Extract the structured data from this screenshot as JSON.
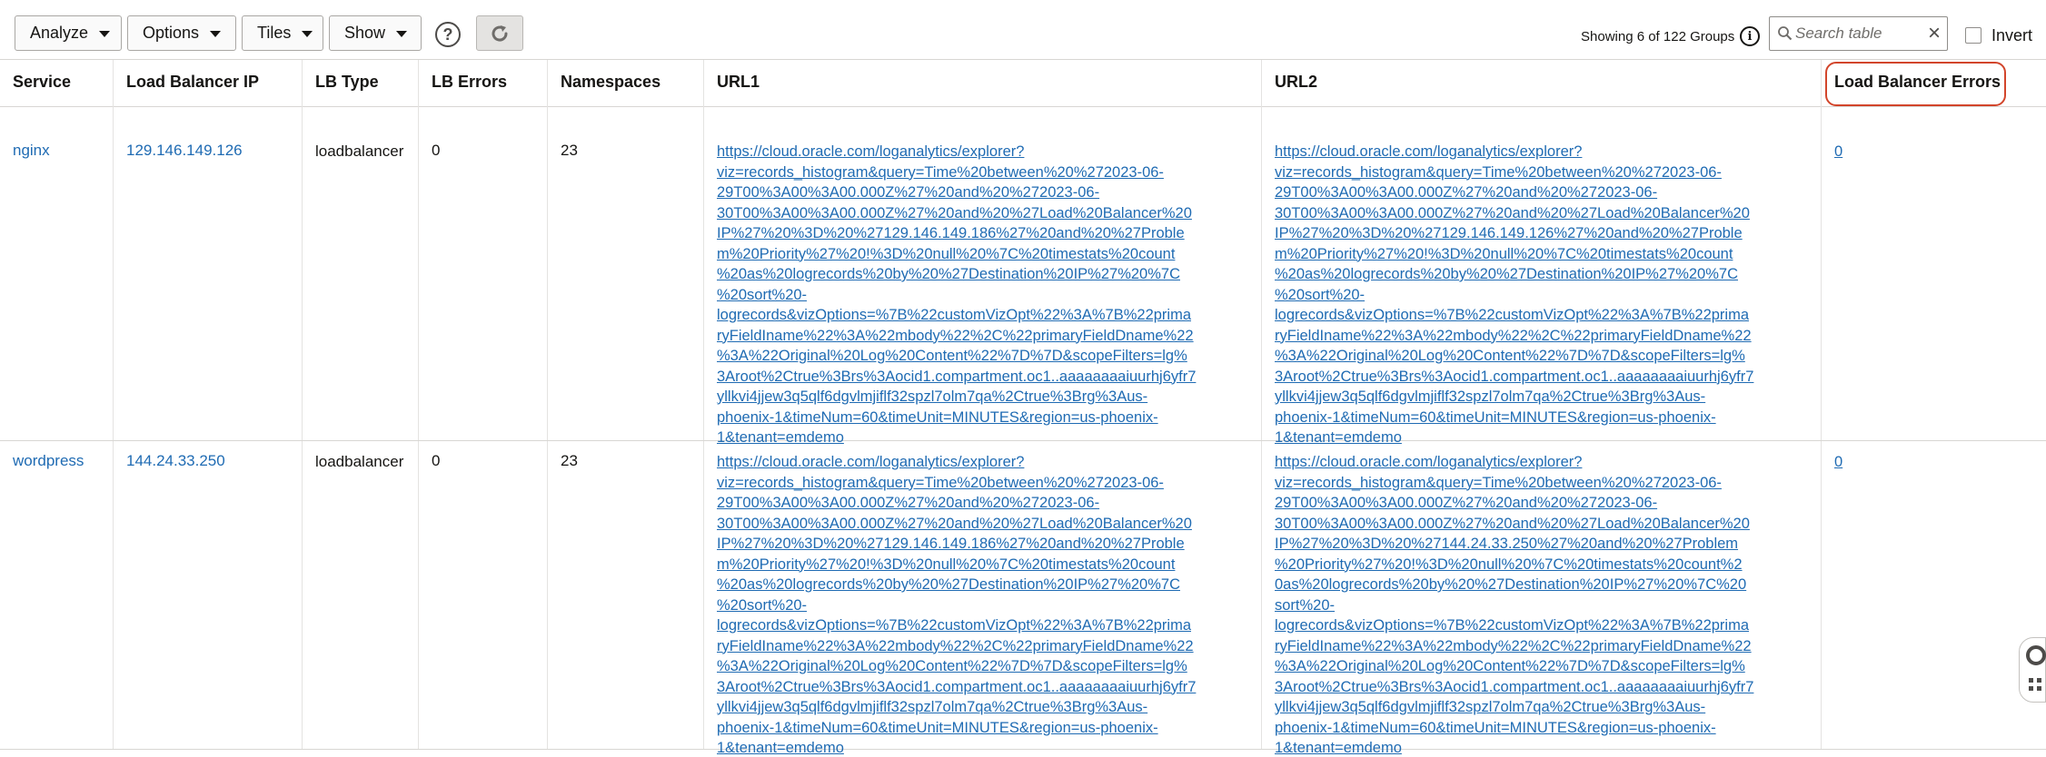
{
  "toolbar": {
    "analyze_label": "Analyze",
    "options_label": "Options",
    "tiles_label": "Tiles",
    "show_label": "Show",
    "help_glyph": "?",
    "showing_text": "Showing 6 of 122 Groups",
    "info_glyph": "i",
    "search_placeholder": "Search table",
    "clear_glyph": "×",
    "invert_label": "Invert",
    "icons": [
      "caret-down-icon",
      "help-icon",
      "refresh-icon",
      "info-icon",
      "search-icon",
      "close-icon"
    ]
  },
  "table": {
    "columns": [
      "Service",
      "Load Balancer IP",
      "LB Type",
      "LB Errors",
      "Namespaces",
      "URL1",
      "URL2",
      "Load Balancer Errors"
    ],
    "highlighted_column": "Load Balancer Errors",
    "rows": [
      {
        "service": "nginx",
        "ip": "129.146.149.126",
        "lb_type": "loadbalancer",
        "lb_errors": "0",
        "namespaces": "23",
        "url1": "https://cloud.oracle.com/loganalytics/explorer?\nviz=records_histogram&query=Time%20between%20%272023-06-\n29T00%3A00%3A00.000Z%27%20and%20%272023-06-\n30T00%3A00%3A00.000Z%27%20and%20%27Load%20Balancer%20\nIP%27%20%3D%20%27129.146.149.186%27%20and%20%27Proble\nm%20Priority%27%20!%3D%20null%20%7C%20timestats%20count\n%20as%20logrecords%20by%20%27Destination%20IP%27%20%7C\n%20sort%20-\nlogrecords&vizOptions=%7B%22customVizOpt%22%3A%7B%22prima\nryFieldIname%22%3A%22mbody%22%2C%22primaryFieldDname%22\n%3A%22Original%20Log%20Content%22%7D%7D&scopeFilters=lg%\n3Aroot%2Ctrue%3Brs%3Aocid1.compartment.oc1..aaaaaaaaiuurhj6yfr7\nyllkvi4jjew3q5qlf6dgvlmjiflf32spzl7olm7qa%2Ctrue%3Brg%3Aus-\nphoenix-1&timeNum=60&timeUnit=MINUTES&region=us-phoenix-\n1&tenant=emdemo",
        "url2": "https://cloud.oracle.com/loganalytics/explorer?\nviz=records_histogram&query=Time%20between%20%272023-06-\n29T00%3A00%3A00.000Z%27%20and%20%272023-06-\n30T00%3A00%3A00.000Z%27%20and%20%27Load%20Balancer%20\nIP%27%20%3D%20%27129.146.149.126%27%20and%20%27Proble\nm%20Priority%27%20!%3D%20null%20%7C%20timestats%20count\n%20as%20logrecords%20by%20%27Destination%20IP%27%20%7C\n%20sort%20-\nlogrecords&vizOptions=%7B%22customVizOpt%22%3A%7B%22prima\nryFieldIname%22%3A%22mbody%22%2C%22primaryFieldDname%22\n%3A%22Original%20Log%20Content%22%7D%7D&scopeFilters=lg%\n3Aroot%2Ctrue%3Brs%3Aocid1.compartment.oc1..aaaaaaaaiuurhj6yfr7\nyllkvi4jjew3q5qlf6dgvlmjiflf32spzl7olm7qa%2Ctrue%3Brg%3Aus-\nphoenix-1&timeNum=60&timeUnit=MINUTES&region=us-phoenix-\n1&tenant=emdemo",
        "lb_errors_link": "0"
      },
      {
        "service": "wordpress",
        "ip": "144.24.33.250",
        "lb_type": "loadbalancer",
        "lb_errors": "0",
        "namespaces": "23",
        "url1": "https://cloud.oracle.com/loganalytics/explorer?\nviz=records_histogram&query=Time%20between%20%272023-06-\n29T00%3A00%3A00.000Z%27%20and%20%272023-06-\n30T00%3A00%3A00.000Z%27%20and%20%27Load%20Balancer%20\nIP%27%20%3D%20%27129.146.149.186%27%20and%20%27Proble\nm%20Priority%27%20!%3D%20null%20%7C%20timestats%20count\n%20as%20logrecords%20by%20%27Destination%20IP%27%20%7C\n%20sort%20-\nlogrecords&vizOptions=%7B%22customVizOpt%22%3A%7B%22prima\nryFieldIname%22%3A%22mbody%22%2C%22primaryFieldDname%22\n%3A%22Original%20Log%20Content%22%7D%7D&scopeFilters=lg%\n3Aroot%2Ctrue%3Brs%3Aocid1.compartment.oc1..aaaaaaaaiuurhj6yfr7\nyllkvi4jjew3q5qlf6dgvlmjiflf32spzl7olm7qa%2Ctrue%3Brg%3Aus-\nphoenix-1&timeNum=60&timeUnit=MINUTES&region=us-phoenix-\n1&tenant=emdemo",
        "url2": "https://cloud.oracle.com/loganalytics/explorer?\nviz=records_histogram&query=Time%20between%20%272023-06-\n29T00%3A00%3A00.000Z%27%20and%20%272023-06-\n30T00%3A00%3A00.000Z%27%20and%20%27Load%20Balancer%20\nIP%27%20%3D%20%27144.24.33.250%27%20and%20%27Problem\n%20Priority%27%20!%3D%20null%20%7C%20timestats%20count%2\n0as%20logrecords%20by%20%27Destination%20IP%27%20%7C%20\nsort%20-\nlogrecords&vizOptions=%7B%22customVizOpt%22%3A%7B%22prima\nryFieldIname%22%3A%22mbody%22%2C%22primaryFieldDname%22\n%3A%22Original%20Log%20Content%22%7D%7D&scopeFilters=lg%\n3Aroot%2Ctrue%3Brs%3Aocid1.compartment.oc1..aaaaaaaaiuurhj6yfr7\nyllkvi4jjew3q5qlf6dgvlmjiflf32spzl7olm7qa%2Ctrue%3Brg%3Aus-\nphoenix-1&timeNum=60&timeUnit=MINUTES&region=us-phoenix-\n1&tenant=emdemo",
        "lb_errors_link": "0"
      }
    ]
  },
  "colors": {
    "link": "#1f6bb3",
    "highlight": "#d2452b",
    "border": "#d8d6d3"
  }
}
